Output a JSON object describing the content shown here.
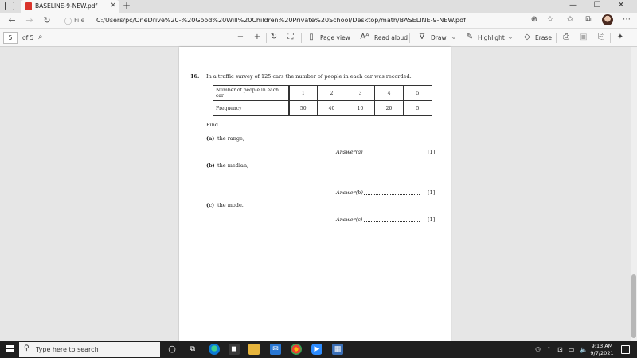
{
  "browser": {
    "tab_title": "BASELINE-9-NEW.pdf",
    "tab_close": "×",
    "new_tab": "+",
    "file_label": "File",
    "url": "C:/Users/pc/OneDrive%20-%20Good%20Will%20Children%20Private%20School/Desktop/math/BASELINE-9-NEW.pdf",
    "window_controls": [
      "—",
      "☐",
      "✕"
    ],
    "nav_icons": [
      "back-icon",
      "forward-icon",
      "refresh-icon"
    ]
  },
  "pdf_toolbar": {
    "page_number": "5",
    "page_total": "of 5",
    "page_view_label": "Page view",
    "read_aloud_label": "Read aloud",
    "draw_label": "Draw",
    "highlight_label": "Highlight",
    "erase_label": "Erase"
  },
  "document": {
    "question_number": "16.",
    "question_text": "In a traffic survey of 125 cars the number of people in each car was recorded.",
    "table": {
      "row1_header": "Number of people in each car",
      "row1_values": [
        "1",
        "2",
        "3",
        "4",
        "5"
      ],
      "row2_header": "Frequency",
      "row2_values": [
        "50",
        "40",
        "10",
        "20",
        "5"
      ]
    },
    "find_label": "Find",
    "parts": [
      {
        "letter": "(a)",
        "text": "the range,",
        "answer_label": "Answer(a)",
        "marks": "[1]"
      },
      {
        "letter": "(b)",
        "text": "the median,",
        "answer_label": "Answer(b)",
        "marks": "[1]"
      },
      {
        "letter": "(c)",
        "text": "the mode.",
        "answer_label": "Answer(c)",
        "marks": "[1]"
      }
    ]
  },
  "taskbar": {
    "search_placeholder": "Type here to search",
    "time": "9:13 AM",
    "date": "9/7/2021",
    "accent_edge": "#0c7bd6"
  }
}
